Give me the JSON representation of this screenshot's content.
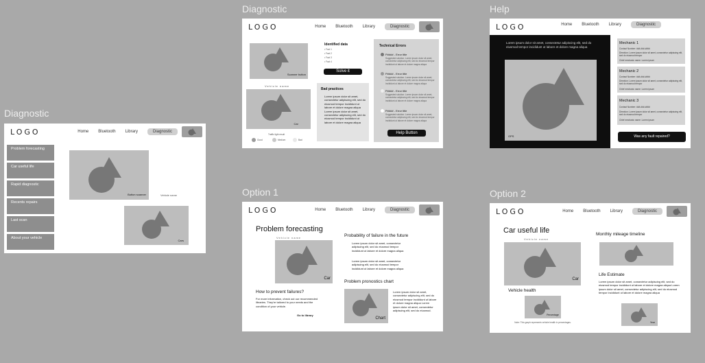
{
  "nav": {
    "logo": "LOGO",
    "home": "Home",
    "bluetooth": "Bluetooth",
    "library": "Library",
    "diagnostic": "Diagnostic"
  },
  "frames": {
    "diag_left": {
      "label": "Diagnostic",
      "sidebar": [
        "Problem forecasting",
        "Car useful life",
        "Rapid diagnostic",
        "Recents repairs",
        "Last scan",
        "About your vehicle"
      ],
      "button_scanner": "Button scanner",
      "vehicle_name": "Vehicle name",
      "cars": "Cars"
    },
    "diag_mid": {
      "label": "Diagnostic",
      "scanner_button": "Scanner button",
      "vehicle_name": "Vehicle name",
      "car": "Car",
      "traffic": "Traffic light result",
      "legend": [
        "Good",
        "Medium",
        "Bad"
      ],
      "identified_title": "Identified data",
      "facts": [
        "• Fact 1",
        "• Fact 2",
        "• Fact 3",
        "• Fact 4"
      ],
      "solve": "Solve it",
      "bad_title": "Bad practices",
      "bad_text": "Lorem ipsum dolor sit amet, consectetur adipiscing elit, sed do eiusmod tempor incididunt ut labore et dolore magna aliqua Lorem ipsum dolor sit amet, consectetur adipiscing elit, sed do eiusmod tempor incididunt ut labore et dolore magna aliqua",
      "tech_title": "Technical Errors",
      "errors": [
        "P#### - Error title",
        "P#### - Error title",
        "P#### - Error title",
        "P#### - Error title"
      ],
      "error_text": "Suggested solution: Lorem ipsum dolor sit amet, consectetur adipiscing elit, sed do eiusmod tempor incididunt ut labore et dolore magna aliqua",
      "help_button": "Help Button"
    },
    "help": {
      "label": "Help",
      "intro": "Lorem ipsum dolor sit amet, consectetur adipiscing elit, sed do eiusmod tempor incididunt ut labore et dolore magna aliqua",
      "gps": "GPS",
      "mechanics": [
        {
          "name": "Mechanic 1"
        },
        {
          "name": "Mechanic 2"
        },
        {
          "name": "Mechanic 3"
        }
      ],
      "contact": "Contact Number: ###-###-####",
      "direction": "Direction: Lorem ipsum dolor sit amet, consectetur adipiscing elit, sed do eiusmod tempor",
      "chief": "Chief mechanic name: Lorem ipsum",
      "fault_button": "Was any fault repaired?"
    },
    "option1": {
      "label": "Option 1",
      "title": "Problem forecasting",
      "vehicle_name": "Vehicle name",
      "car": "Car",
      "prevent_title": "How to prevent failures?",
      "prevent_text": "For more information, check out our recommended libraries. They're tailored to your needs and the condition of your vehicle.",
      "go_library": "Go to library",
      "prob_title": "Probability of failure in the future",
      "bullet": "Lorem ipsum dolor sit amet, consectetur adipiscing elit, sed do eiusmod tempor incididunt ut labore et dolore magna aliqua",
      "prog_title": "Problem pronostics chart",
      "chart": "Chart",
      "prog_text": "Lorem ipsum dolor sit amet, consectetur adipiscing elit, sed do eiusmod tempor incididunt ut labore et dolore magna aliqua Lorem ipsum dolor sit amet, consectetur adipiscing elit, sed do eiusmod."
    },
    "option2": {
      "label": "Option 2",
      "title": "Car useful life",
      "vehicle_name": "Vehicle name",
      "car": "Car",
      "health_title": "Vehicle health",
      "health_ph": "Percentage",
      "note": "Note: This graph represents vehicle health in percentages.",
      "monthly_title": "Monthly mileage timeline",
      "life_title": "Life Estimate",
      "life_text": "Lorem ipsum dolor sit amet, consectetur adipiscing elit, sed do eiusmod tempor incididunt ut labore et dolore magna aliqua Lorem ipsum dolor sit amet, consectetur adipiscing elit, sed do eiusmod tempor incididunt ut labore et dolore magna aliqua",
      "year": "Year"
    }
  }
}
